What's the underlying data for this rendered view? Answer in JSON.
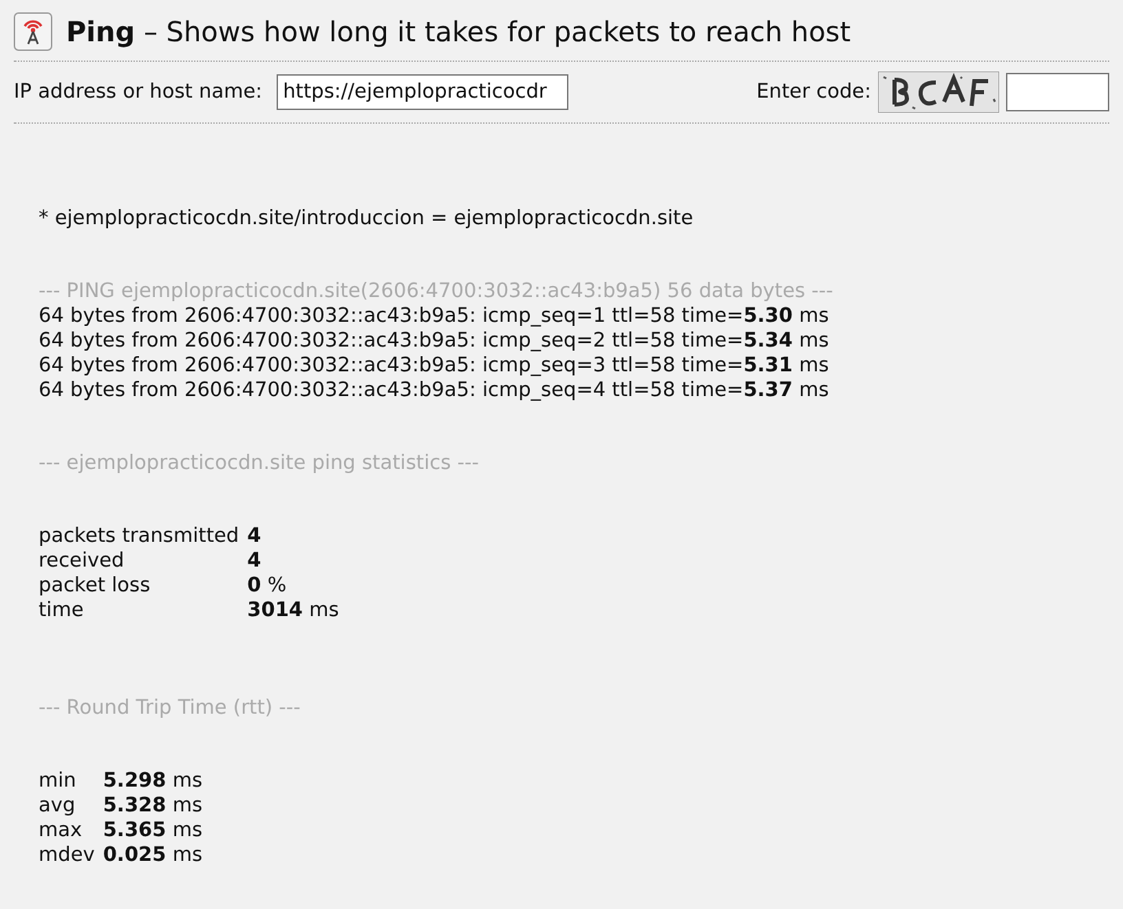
{
  "header": {
    "title": "Ping",
    "subtitle": "– Shows how long it takes for packets to reach host"
  },
  "form": {
    "host_label": "IP address or host name:",
    "host_value": "https://ejemplopracticocdr",
    "code_label": "Enter code:"
  },
  "result": {
    "resolved": "* ejemplopracticocdn.site/introduccion = ejemplopracticocdn.site",
    "ping_header": "--- PING ejemplopracticocdn.site(2606:4700:3032::ac43:b9a5) 56 data bytes ---",
    "replies": [
      "64 bytes from 2606:4700:3032::ac43:b9a5: icmp_seq=1 ttl=58 time=**5.30** ms",
      "64 bytes from 2606:4700:3032::ac43:b9a5: icmp_seq=2 ttl=58 time=**5.34** ms",
      "64 bytes from 2606:4700:3032::ac43:b9a5: icmp_seq=3 ttl=58 time=**5.31** ms",
      "64 bytes from 2606:4700:3032::ac43:b9a5: icmp_seq=4 ttl=58 time=**5.37** ms"
    ],
    "stats_header": "--- ejemplopracticocdn.site ping statistics ---",
    "stats": [
      {
        "label": "packets transmitted",
        "value": "**4**"
      },
      {
        "label": "received",
        "value": "**4**"
      },
      {
        "label": "packet loss",
        "value": "**0** %"
      },
      {
        "label": "time",
        "value": "**3014** ms"
      }
    ],
    "rtt_header": "--- Round Trip Time (rtt) ---",
    "rtt": [
      {
        "label": "min",
        "value": "**5.298** ms"
      },
      {
        "label": "avg",
        "value": "**5.328** ms"
      },
      {
        "label": "max",
        "value": "**5.365** ms"
      },
      {
        "label": "mdev",
        "value": "**0.025** ms"
      }
    ]
  }
}
